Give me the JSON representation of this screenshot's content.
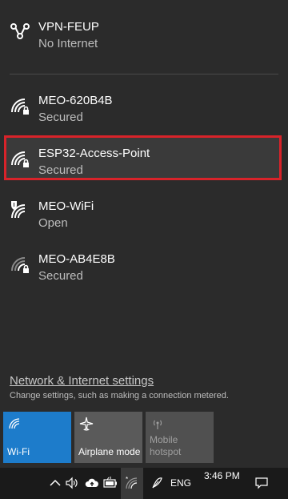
{
  "networks": [
    {
      "name": "VPN-FEUP",
      "status": "No Internet",
      "icon": "vpn-icon"
    },
    {
      "name": "MEO-620B4B",
      "status": "Secured",
      "icon": "wifi-secured-icon"
    },
    {
      "name": "ESP32-Access-Point",
      "status": "Secured",
      "icon": "wifi-secured-icon",
      "selected": true
    },
    {
      "name": "MEO-WiFi",
      "status": "Open",
      "icon": "wifi-open-shield-icon"
    },
    {
      "name": "MEO-AB4E8B",
      "status": "Secured",
      "icon": "wifi-secured-icon"
    }
  ],
  "settings": {
    "link": "Network & Internet settings",
    "description": "Change settings, such as making a connection metered."
  },
  "tiles": [
    {
      "label": "Wi-Fi",
      "icon": "wifi-icon",
      "active": true
    },
    {
      "label": "Airplane mode",
      "icon": "airplane-icon",
      "active": false
    },
    {
      "label_line1": "Mobile",
      "label_line2": "hotspot",
      "icon": "hotspot-icon",
      "disabled": true
    }
  ],
  "taskbar": {
    "language": "ENG",
    "time": "3:46 PM",
    "icons": [
      "chevron-up-icon",
      "volume-icon",
      "cloud-upload-icon",
      "battery-icon",
      "wifi-icon",
      "pen-icon",
      "notification-icon"
    ]
  },
  "colors": {
    "background": "#2b2b2b",
    "accent": "#1d7ccb",
    "highlight_border": "#d8232a",
    "taskbar": "#1a1a1a"
  }
}
